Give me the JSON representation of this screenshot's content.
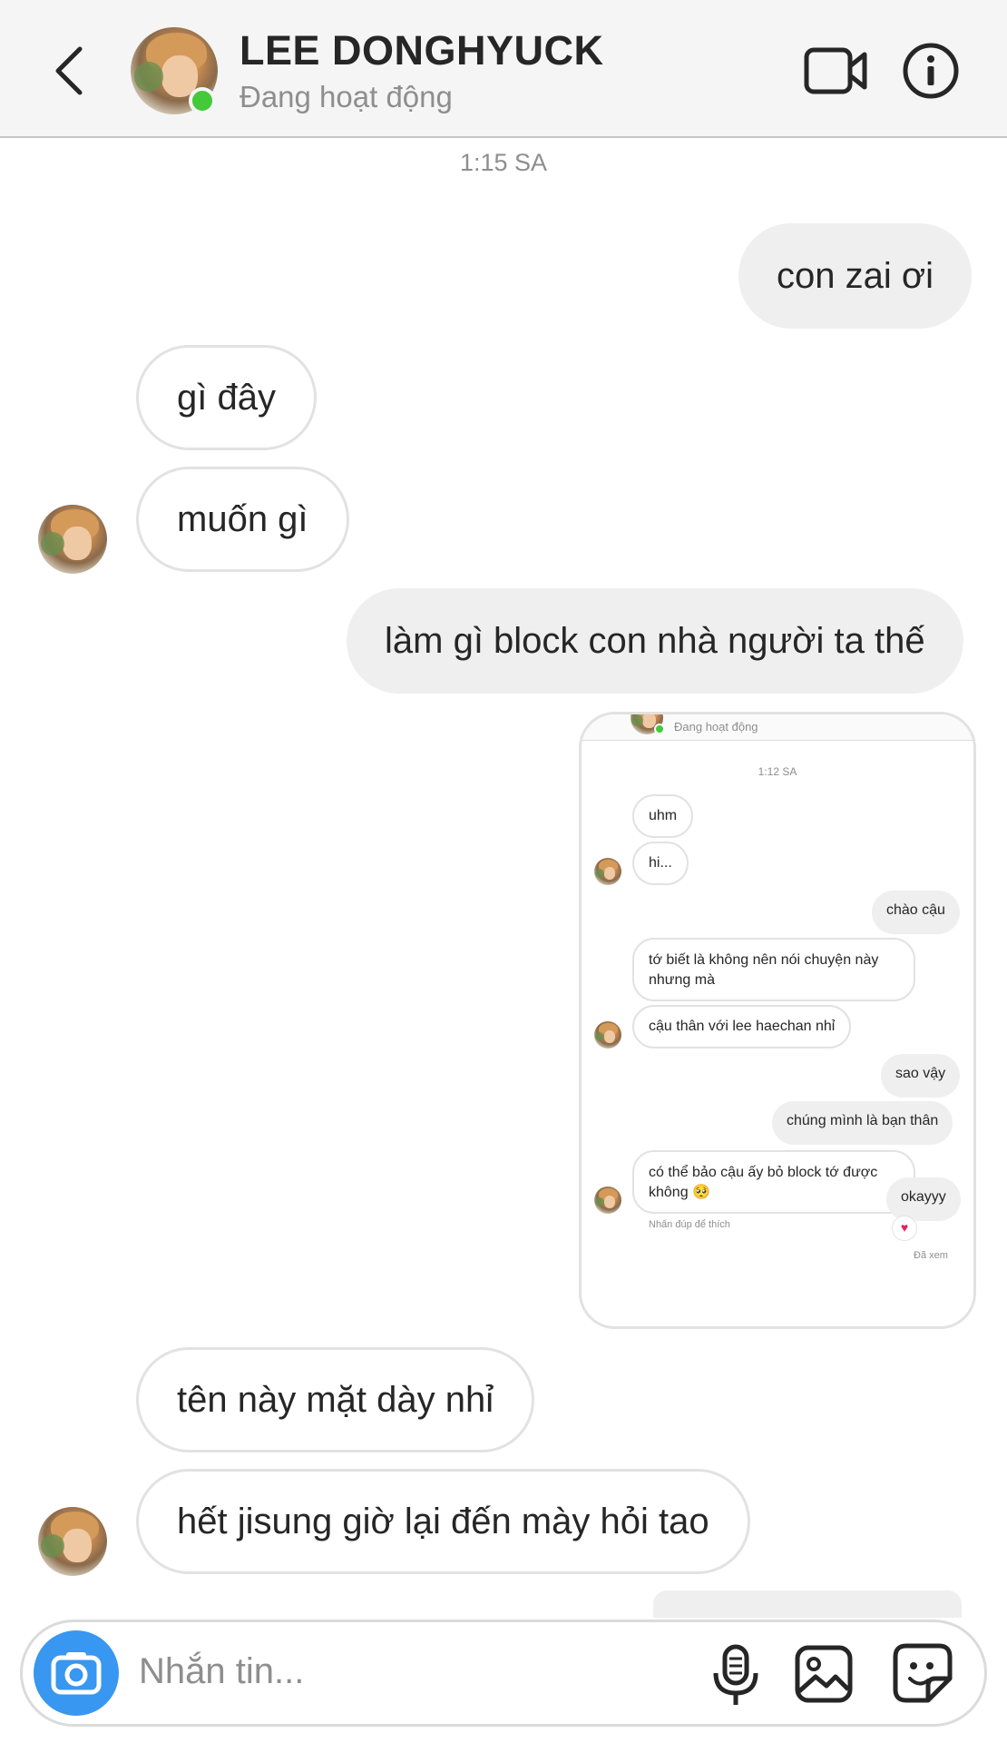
{
  "header": {
    "contact_name": "LEE DONGHYUCK",
    "status": "Đang hoạt động"
  },
  "timestamp": "1:15 SA",
  "messages": [
    {
      "side": "out",
      "text": "con zai ơi"
    },
    {
      "side": "in",
      "text": "gì đây"
    },
    {
      "side": "in",
      "text": "muốn gì"
    },
    {
      "side": "out",
      "text": "làm gì block con nhà người ta thế"
    },
    {
      "side": "in",
      "text": "tên này mặt dày nhỉ"
    },
    {
      "side": "in",
      "text": "hết jisung giờ lại đến mày hỏi tao"
    }
  ],
  "shared_screenshot": {
    "status": "Đang hoạt động",
    "timestamp": "1:12 SA",
    "messages": [
      {
        "side": "in",
        "text": "uhm"
      },
      {
        "side": "in",
        "text": "hi..."
      },
      {
        "side": "out",
        "text": "chào cậu"
      },
      {
        "side": "in",
        "text": "tớ biết là không nên nói chuyện này nhưng mà"
      },
      {
        "side": "in",
        "text": "cậu thân với lee haechan nhỉ"
      },
      {
        "side": "out",
        "text": "sao vậy"
      },
      {
        "side": "out",
        "text": "chúng mình là bạn thân"
      },
      {
        "side": "in",
        "text": "có thể bảo cậu ấy bỏ block tớ được không 🥺"
      },
      {
        "side": "out",
        "text": "okayyy"
      }
    ],
    "hint": "Nhấn đúp để thích",
    "reaction": "♥",
    "seen": "Đã xem"
  },
  "composer": {
    "placeholder": "Nhắn tin..."
  },
  "colors": {
    "online": "#44c93a",
    "camera_button": "#3897f0",
    "outgoing_bubble": "#efefef",
    "incoming_border": "#e2e2e2"
  },
  "icons": [
    "back-arrow-icon",
    "video-call-icon",
    "info-icon",
    "camera-icon",
    "microphone-icon",
    "gallery-icon",
    "sticker-icon"
  ]
}
